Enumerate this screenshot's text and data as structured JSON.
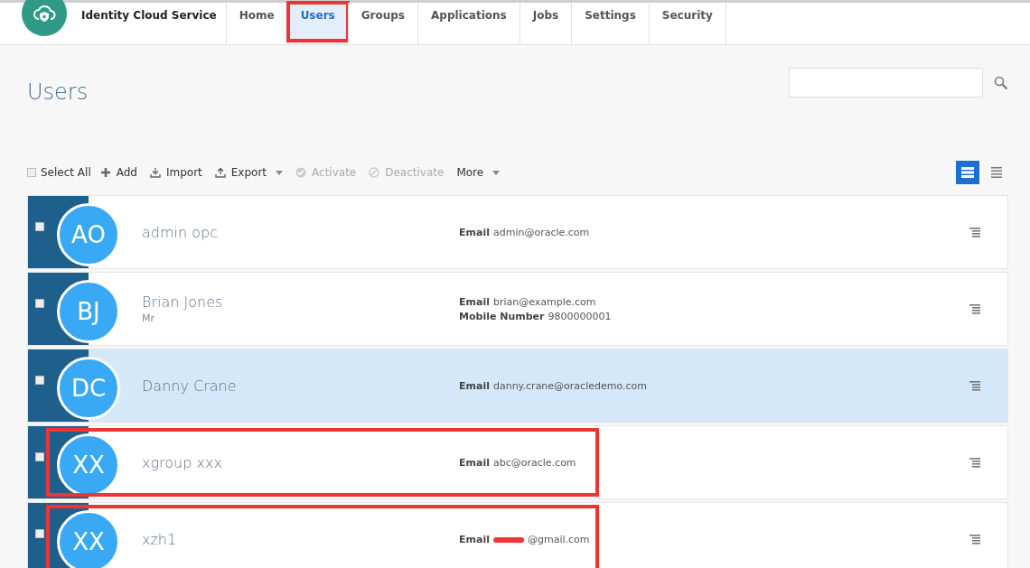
{
  "app": {
    "title": "Identity Cloud Service"
  },
  "tabs": [
    {
      "label": "Home",
      "selected": false,
      "highlighted": false
    },
    {
      "label": "Users",
      "selected": true,
      "highlighted": true
    },
    {
      "label": "Groups",
      "selected": false,
      "highlighted": false
    },
    {
      "label": "Applications",
      "selected": false,
      "highlighted": false
    },
    {
      "label": "Jobs",
      "selected": false,
      "highlighted": false
    },
    {
      "label": "Settings",
      "selected": false,
      "highlighted": false
    },
    {
      "label": "Security",
      "selected": false,
      "highlighted": false
    }
  ],
  "page": {
    "title": "Users"
  },
  "toolbar": {
    "select_all": {
      "label": "Select All",
      "checked": false
    },
    "actions": [
      {
        "label": "Add",
        "kind": "add",
        "disabled": false,
        "dropdown": false
      },
      {
        "label": "Import",
        "kind": "import",
        "disabled": false,
        "dropdown": false
      },
      {
        "label": "Export",
        "kind": "export",
        "disabled": false,
        "dropdown": true
      },
      {
        "label": "Activate",
        "kind": "activate",
        "disabled": true,
        "dropdown": false
      },
      {
        "label": "Deactivate",
        "kind": "deactivate",
        "disabled": true,
        "dropdown": false
      },
      {
        "label": "More",
        "kind": "more",
        "disabled": false,
        "dropdown": true
      }
    ],
    "views": [
      {
        "kind": "cards",
        "selected": true
      },
      {
        "kind": "list",
        "selected": false
      }
    ]
  },
  "users": [
    {
      "initials": "AO",
      "name": "admin opc",
      "checked": false,
      "selected": false,
      "highlighted": false,
      "fields": [
        {
          "label": "Email",
          "value": "admin@oracle.com",
          "redacted": false
        }
      ]
    },
    {
      "initials": "BJ",
      "name": "Brian Jones",
      "subtitle": "Mr",
      "checked": false,
      "selected": false,
      "highlighted": false,
      "fields": [
        {
          "label": "Email",
          "value": "brian@example.com",
          "redacted": false
        },
        {
          "label": "Mobile Number",
          "value": "9800000001",
          "redacted": false
        }
      ]
    },
    {
      "initials": "DC",
      "name": "Danny Crane",
      "checked": false,
      "selected": true,
      "highlighted": false,
      "fields": [
        {
          "label": "Email",
          "value": "danny.crane@oracledemo.com",
          "redacted": false
        }
      ]
    },
    {
      "initials": "XX",
      "name": "xgroup xxx",
      "checked": false,
      "selected": false,
      "highlighted": true,
      "fields": [
        {
          "label": "Email",
          "value": "abc@oracle.com",
          "redacted": false
        }
      ]
    },
    {
      "initials": "XX",
      "name": "xzh1",
      "checked": false,
      "selected": false,
      "highlighted": true,
      "fields": [
        {
          "label": "Email",
          "value": "@gmail.com",
          "redacted": true
        }
      ]
    }
  ]
}
